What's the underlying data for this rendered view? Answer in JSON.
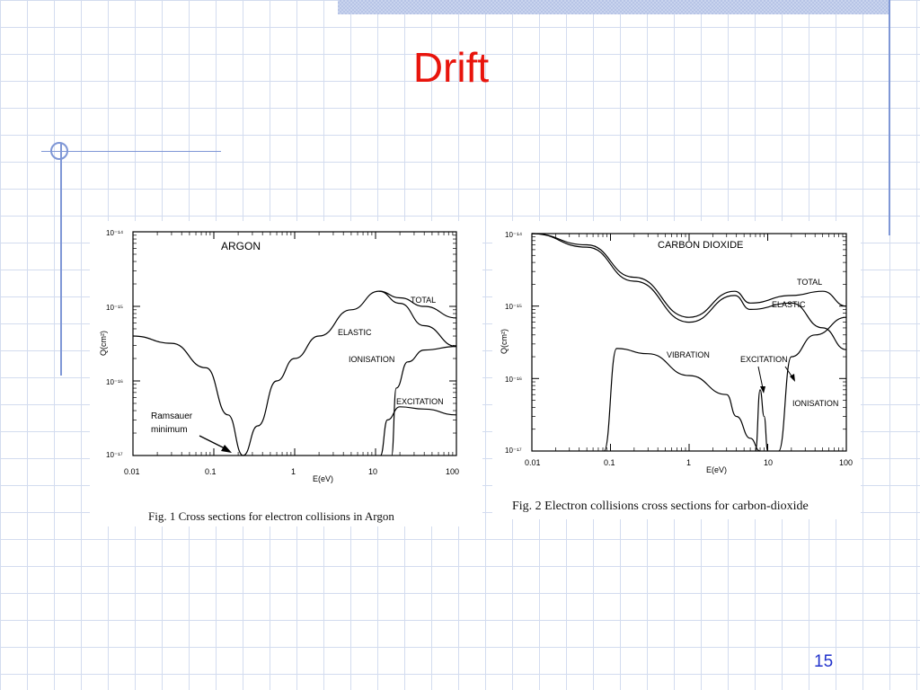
{
  "slide": {
    "title": "Drift",
    "page_number": "15"
  },
  "figures": {
    "argon": {
      "caption": "Fig. 1 Cross sections for electron collisions in Argon",
      "panel_title": "ARGON",
      "ylabel": "Q(cm²)",
      "xlabel": "E(eV)",
      "y_ticks": [
        "10⁻¹⁴",
        "10⁻¹⁵",
        "10⁻¹⁶",
        "10⁻¹⁷"
      ],
      "x_ticks": [
        "0.01",
        "0.1",
        "1",
        "10",
        "100"
      ],
      "curve_labels": [
        "TOTAL",
        "ELASTIC",
        "IONISATION",
        "EXCITATION"
      ],
      "annotation_line1": "Ramsauer",
      "annotation_line2": "minimum"
    },
    "co2": {
      "caption": "Fig. 2 Electron collisions cross sections for carbon-dioxide",
      "panel_title": "CARBON DIOXIDE",
      "ylabel": "Q(cm²)",
      "xlabel": "E(eV)",
      "y_ticks": [
        "10⁻¹⁴",
        "10⁻¹⁵",
        "10⁻¹⁶",
        "10⁻¹⁷"
      ],
      "x_ticks": [
        "0.01",
        "0.1",
        "1",
        "10",
        "100"
      ],
      "curve_labels": [
        "TOTAL",
        "ELASTIC",
        "VIBRATION",
        "EXCITATION",
        "IONISATION"
      ]
    }
  },
  "chart_data": [
    {
      "type": "line",
      "title": "ARGON",
      "xlabel": "E(eV)",
      "ylabel": "Q(cm²)",
      "x_scale": "log",
      "y_scale": "log",
      "xlim": [
        0.01,
        100
      ],
      "ylim": [
        1e-17,
        1e-14
      ],
      "series": [
        {
          "name": "ELASTIC",
          "x": [
            0.01,
            0.03,
            0.08,
            0.15,
            0.23,
            0.35,
            0.6,
            1,
            2,
            5,
            11,
            20,
            40,
            100
          ],
          "y": [
            4e-16,
            3.2e-16,
            1.5e-16,
            3.5e-17,
            1e-17,
            2.5e-17,
            1e-16,
            2e-16,
            4e-16,
            9e-16,
            1.6e-15,
            1.1e-15,
            5.5e-16,
            2.9e-16
          ]
        },
        {
          "name": "TOTAL",
          "x": [
            11,
            20,
            40,
            100
          ],
          "y": [
            1.6e-15,
            1.3e-15,
            1e-15,
            7e-16
          ]
        },
        {
          "name": "IONISATION",
          "x": [
            15.8,
            18,
            25,
            40,
            100
          ],
          "y": [
            1e-17,
            8e-17,
            1.8e-16,
            2.6e-16,
            2.9e-16
          ]
        },
        {
          "name": "EXCITATION",
          "x": [
            11.5,
            14,
            20,
            40,
            100
          ],
          "y": [
            1e-17,
            3e-17,
            4.5e-17,
            4.2e-17,
            3.5e-17
          ]
        }
      ]
    },
    {
      "type": "line",
      "title": "CARBON DIOXIDE",
      "xlabel": "E(eV)",
      "ylabel": "Q(cm²)",
      "x_scale": "log",
      "y_scale": "log",
      "xlim": [
        0.01,
        100
      ],
      "ylim": [
        1e-17,
        1e-14
      ],
      "series": [
        {
          "name": "TOTAL",
          "x": [
            0.01,
            0.05,
            0.2,
            1,
            3.8,
            6,
            20,
            50,
            100
          ],
          "y": [
            1e-14,
            7e-15,
            2.5e-15,
            7e-16,
            1.6e-15,
            1.1e-15,
            1.4e-15,
            1.6e-15,
            1e-15
          ]
        },
        {
          "name": "ELASTIC",
          "x": [
            0.01,
            0.05,
            0.2,
            1,
            3.8,
            6,
            20,
            50,
            100
          ],
          "y": [
            1e-14,
            6.5e-15,
            2.2e-15,
            6e-16,
            1.4e-15,
            9e-16,
            1.1e-15,
            5e-16,
            2.5e-16
          ]
        },
        {
          "name": "VIBRATION",
          "x": [
            0.083,
            0.12,
            0.3,
            1,
            3,
            4,
            6,
            8
          ],
          "y": [
            1e-17,
            2.6e-16,
            2.2e-16,
            1.1e-16,
            6e-17,
            3e-17,
            1.5e-17,
            1e-17
          ]
        },
        {
          "name": "EXCITATION",
          "x": [
            7,
            8,
            9,
            10
          ],
          "y": [
            1e-17,
            7e-17,
            3e-17,
            1e-17
          ]
        },
        {
          "name": "IONISATION",
          "x": [
            13.8,
            20,
            40,
            100
          ],
          "y": [
            1e-17,
            2e-16,
            4e-16,
            7e-16
          ]
        }
      ]
    }
  ]
}
